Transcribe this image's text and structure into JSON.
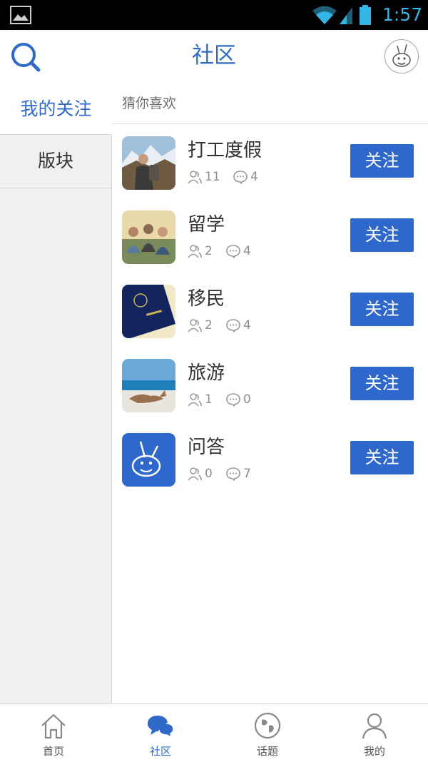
{
  "status_bar": {
    "time": "1:57",
    "icons": [
      "gallery-icon",
      "wifi-icon",
      "signal-icon",
      "battery-icon"
    ],
    "accent_color": "#33b5e5"
  },
  "header": {
    "title": "社区",
    "search_icon": "search-icon",
    "avatar_icon": "kangaroo-avatar"
  },
  "left_tabs": [
    {
      "label": "我的关注",
      "active": true
    },
    {
      "label": "版块",
      "active": false
    }
  ],
  "section": {
    "label": "猜你喜欢"
  },
  "boards": [
    {
      "name": "打工度假",
      "members": "11",
      "posts": "4",
      "follow_label": "关注",
      "image": "backpacker-mountains-photo"
    },
    {
      "name": "留学",
      "members": "2",
      "posts": "4",
      "follow_label": "关注",
      "image": "students-group-photo"
    },
    {
      "name": "移民",
      "members": "2",
      "posts": "4",
      "follow_label": "关注",
      "image": "passport-photo"
    },
    {
      "name": "旅游",
      "members": "1",
      "posts": "0",
      "follow_label": "关注",
      "image": "kangaroo-beach-photo"
    },
    {
      "name": "问答",
      "members": "0",
      "posts": "7",
      "follow_label": "关注",
      "image": "kangaroo-mascot-icon"
    }
  ],
  "bottom_nav": [
    {
      "label": "首页",
      "icon": "home-icon",
      "active": false
    },
    {
      "label": "社区",
      "icon": "chat-bubbles-icon",
      "active": true
    },
    {
      "label": "话题",
      "icon": "globe-icon",
      "active": false
    },
    {
      "label": "我的",
      "icon": "person-icon",
      "active": false
    }
  ],
  "colors": {
    "brand": "#2f6ac8",
    "button": "#2f68cd",
    "left_panel": "#f0f0f0"
  }
}
